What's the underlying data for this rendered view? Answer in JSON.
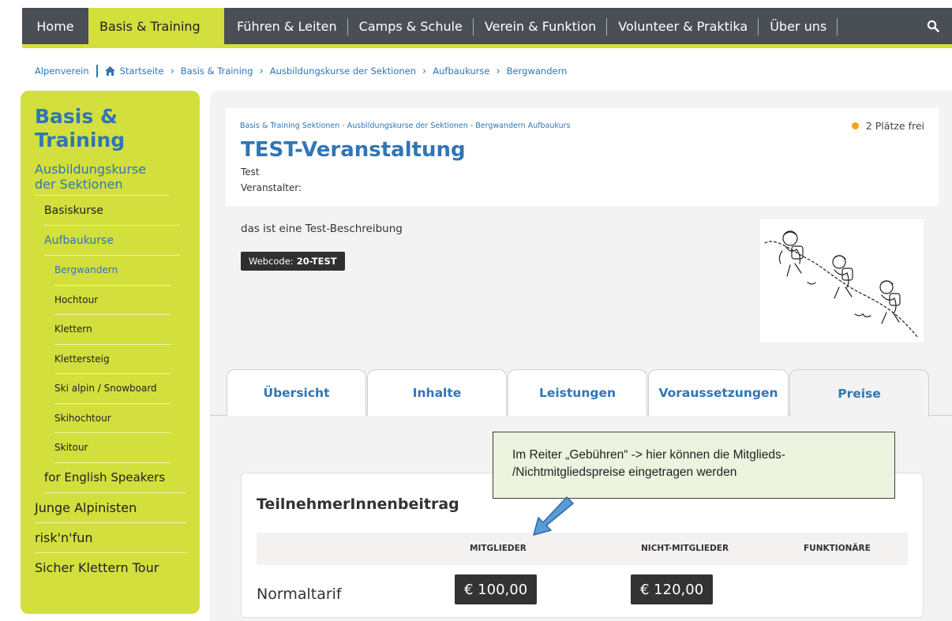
{
  "nav": {
    "items": [
      {
        "label": "Home"
      },
      {
        "label": "Basis & Training"
      },
      {
        "label": "Führen & Leiten"
      },
      {
        "label": "Camps & Schule"
      },
      {
        "label": "Verein & Funktion"
      },
      {
        "label": "Volunteer & Praktika"
      },
      {
        "label": "Über uns"
      }
    ],
    "search_icon": "search-icon"
  },
  "breadcrumb": {
    "root": "Alpenverein",
    "items": [
      "Startseite",
      "Basis & Training",
      "Ausbildungskurse der Sektionen",
      "Aufbaukurse",
      "Bergwandern"
    ]
  },
  "sidebar": {
    "title": "Basis & Training",
    "subtitle": "Ausbildungskurse der Sektionen",
    "items": {
      "basiskurse": "Basiskurse",
      "aufbaukurse": "Aufbaukurse",
      "bergwandern": "Bergwandern",
      "hochtour": "Hochtour",
      "klettern": "Klettern",
      "klettersteig": "Klettersteig",
      "ski": "Ski alpin / Snowboard",
      "skihochtour": "Skihochtour",
      "skitour": "Skitour",
      "english": "for English Speakers"
    },
    "bottom": {
      "junge": "Junge Alpinisten",
      "risk": "risk'n'fun",
      "sicher": "Sicher Klettern Tour"
    }
  },
  "event": {
    "category": "Basis & Training Sektionen - Ausbildungskurse der Sektionen - Bergwandern Aufbaukurs",
    "title": "TEST-Veranstaltung",
    "subtitle": "Test",
    "organizer_label": "Veranstalter:",
    "places": "2 Plätze frei",
    "description": "das ist eine Test-Beschreibung",
    "webcode_label": "Webcode:",
    "webcode_value": "20-TEST"
  },
  "tabs": {
    "overview": "Übersicht",
    "content": "Inhalte",
    "services": "Leistungen",
    "requirements": "Voraussetzungen",
    "prices": "Preise"
  },
  "prices": {
    "title": "TeilnehmerInnenbeitrag",
    "col_members": "MITGLIEDER",
    "col_nonmembers": "NICHT-MITGLIEDER",
    "col_officials": "FUNKTIONÄRE",
    "row_label": "Normaltarif",
    "member_price": "€ 100,00",
    "nonmember_price": "€ 120,00"
  },
  "annotation": {
    "line1": "Im Reiter „Gebühren“ -> hier können die Mitglieds-",
    "line2": "/Nichtmitgliedspreise eingetragen werden"
  },
  "colors": {
    "brand_green": "#d3df3c",
    "brand_blue": "#2f76b6",
    "nav_dark": "#4a4f55",
    "places_dot": "#f2a31b"
  }
}
